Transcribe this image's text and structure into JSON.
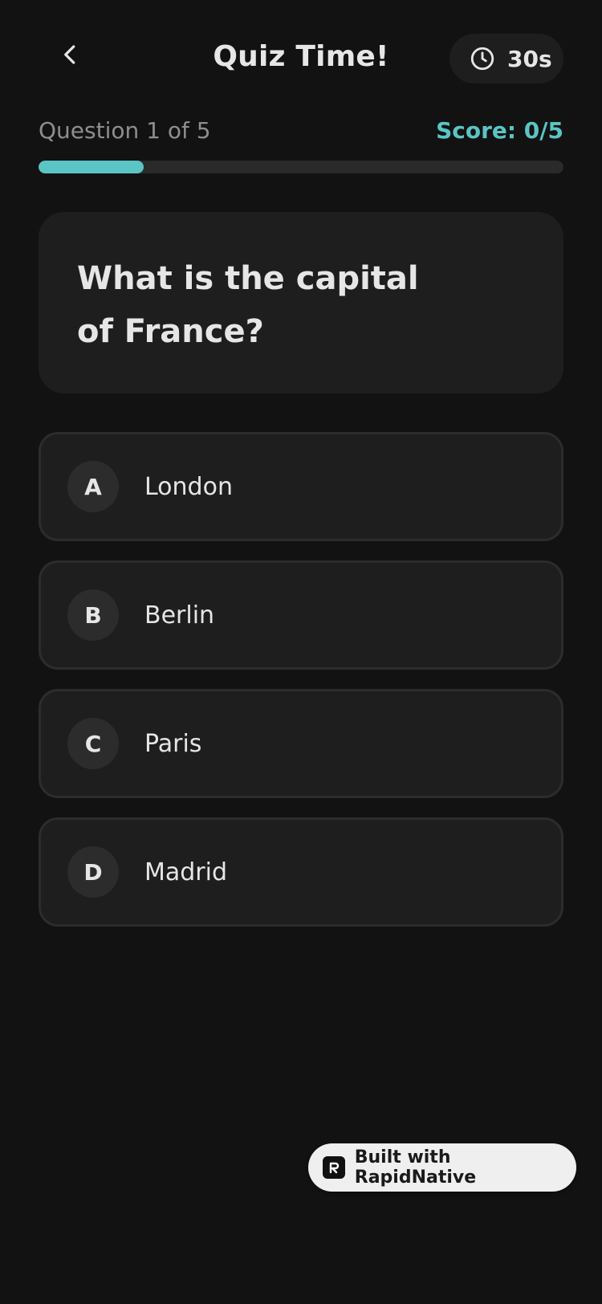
{
  "header": {
    "title": "Quiz Time!",
    "back_icon": "chevron-left-icon",
    "timer": {
      "icon": "clock-icon",
      "value": "30s"
    }
  },
  "progress": {
    "label": "Question 1 of 5",
    "score": "Score: 0/5",
    "fraction": 0.2,
    "color": "#5BC4C4"
  },
  "question": {
    "text": "What is the capital of France?"
  },
  "options": [
    {
      "letter": "A",
      "label": "London"
    },
    {
      "letter": "B",
      "label": "Berlin"
    },
    {
      "letter": "C",
      "label": "Paris"
    },
    {
      "letter": "D",
      "label": "Madrid"
    }
  ],
  "badge": {
    "label": "Built with RapidNative",
    "icon": "rapidnative-logo-icon"
  },
  "colors": {
    "background": "#121212",
    "card": "#1E1E1E",
    "accent": "#5BC4C4",
    "muted": "#8E8E8E"
  }
}
